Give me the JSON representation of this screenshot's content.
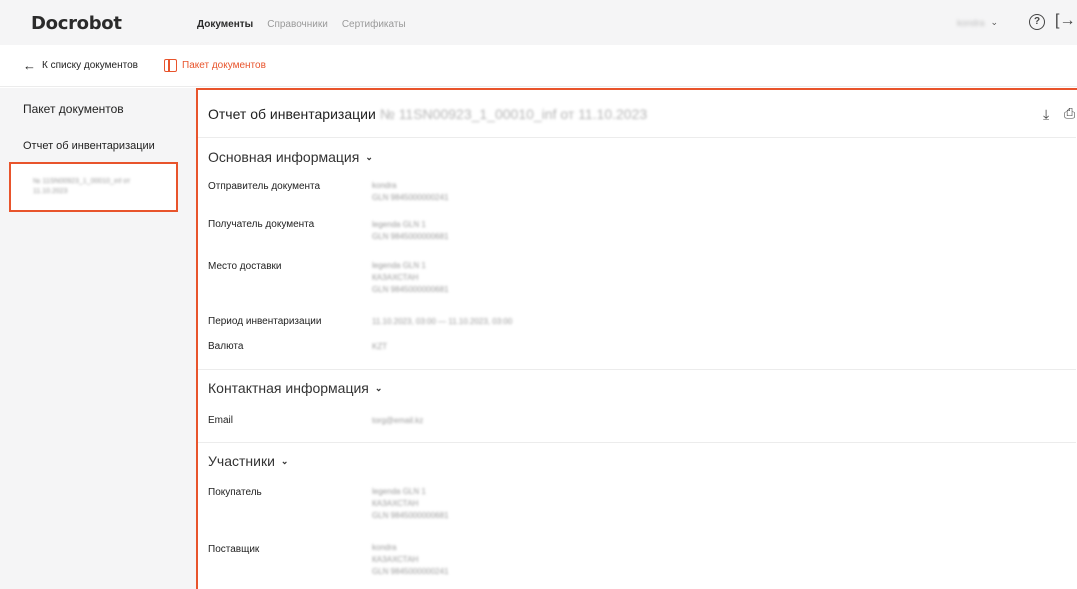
{
  "app": {
    "logo": "Docrobot"
  },
  "nav": {
    "documents": "Документы",
    "directories": "Справочники",
    "certificates": "Сертификаты"
  },
  "user": {
    "name": "kondra"
  },
  "crumb": {
    "back": "К списку документов",
    "package": "Пакет документов"
  },
  "sidebar": {
    "title": "Пакет документов",
    "item": "Отчет об инвентаризации",
    "doc": "№ 11SN00923_1_00010_inf от 11.10.2023"
  },
  "document": {
    "title": "Отчет об инвентаризации",
    "number": "№ 11SN00923_1_00010_inf от 11.10.2023"
  },
  "sections": {
    "basic": {
      "title": "Основная информация",
      "sender_label": "Отправитель документа",
      "sender_name": "kondra",
      "sender_gln": "GLN 9845000000241",
      "receiver_label": "Получатель документа",
      "receiver_name": "legenda GLN 1",
      "receiver_gln": "GLN 9845000000681",
      "delivery_label": "Место доставки",
      "delivery_name": "legenda GLN 1",
      "delivery_country": "КАЗАХСТАН",
      "delivery_gln": "GLN 9845000000681",
      "period_label": "Период инвентаризации",
      "period_value": "11.10.2023, 03:00 — 11.10.2023, 03:00",
      "currency_label": "Валюта",
      "currency_value": "KZT"
    },
    "contact": {
      "title": "Контактная информация",
      "email_label": "Email",
      "email_value": "torg@email.kz"
    },
    "participants": {
      "title": "Участники",
      "buyer_label": "Покупатель",
      "buyer_name": "legenda GLN 1",
      "buyer_country": "КАЗАХСТАН",
      "buyer_gln": "GLN 9845000000681",
      "supplier_label": "Поставщик",
      "supplier_name": "kondra",
      "supplier_country": "КАЗАХСТАН",
      "supplier_gln": "GLN 9845000000241"
    }
  },
  "colors": {
    "accent": "#e8542c",
    "sidebar_bg": "#f5f5f6"
  }
}
